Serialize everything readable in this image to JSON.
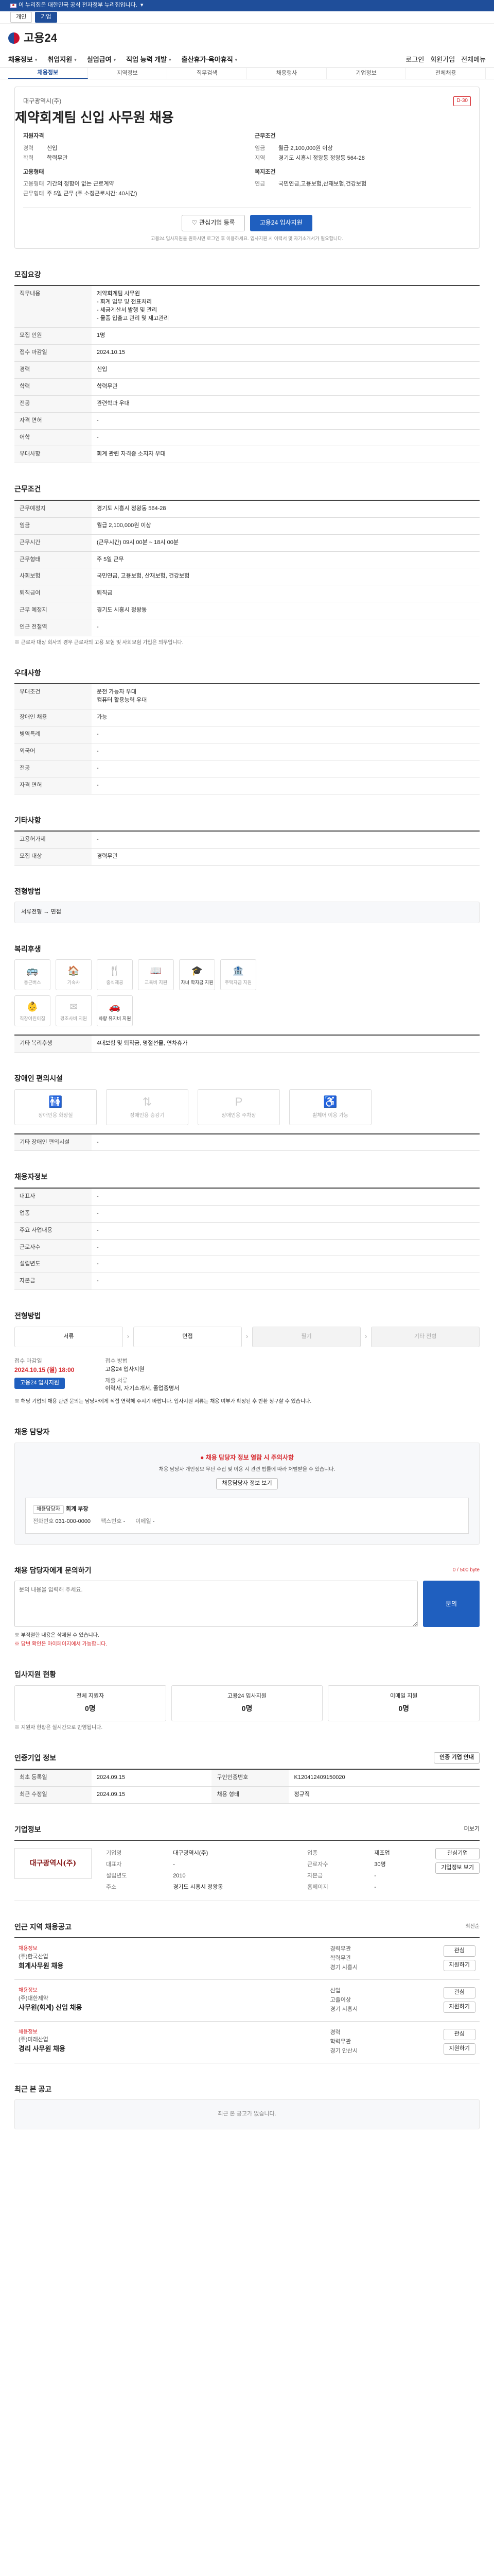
{
  "gov_banner": "이 누리집은 대한민국 공식 전자정부 누리집입니다.",
  "topbar": {
    "left": "개인",
    "right": "기업"
  },
  "logo": "고용24",
  "gnb": [
    "채용정보",
    "취업지원",
    "실업급여",
    "직업 능력 개발",
    "출산휴가·육아휴직"
  ],
  "gnb_right": [
    "로그인",
    "회원가입",
    "전체메뉴"
  ],
  "subnav": [
    "채용정보",
    "지역정보",
    "직무검색",
    "채용행사",
    "기업정보",
    "전체채용"
  ],
  "job": {
    "company": "대구광역시(주)",
    "title": "제약회계팀 신입 사무원 채용",
    "dday": "D-30",
    "qual_title": "지원자격",
    "qual": [
      [
        "경력",
        "신입"
      ],
      [
        "학력",
        "학력무관"
      ]
    ],
    "cond_title": "근무조건",
    "cond": [
      [
        "임금",
        "월급 2,100,000원 이상"
      ],
      [
        "지역",
        "경기도 시흥시 정왕동 정왕동 564-28"
      ]
    ],
    "form_title": "고용형태",
    "form": [
      [
        "고용형태",
        "기간의 정함이 없는 근로계약"
      ],
      [
        "근무형태",
        "주 5일 근무 (주 소정근로시간: 40시간)"
      ]
    ],
    "welfare_title": "복지조건",
    "welfare": [
      [
        "연금",
        "국민연금,고용보험,산재보험,건강보험"
      ]
    ],
    "btn_fav": "관심기업 등록",
    "btn_apply": "고용24 입사지원",
    "note": "고용24 입사지원을 원하시면 로그인 후 이용하세요. 입사지원 시 이력서 및 자기소개서가 필요합니다."
  },
  "recruit": {
    "title": "모집요강",
    "rows": [
      [
        "직무내용",
        "제약회계팀 사무원\n- 회계 업무 및 전표처리\n- 세금계산서 발행 및 관리\n- 물품 입출고 관리 및 재고관리"
      ],
      [
        "모집 인원",
        "1명"
      ],
      [
        "접수 마감일",
        "2024.10.15"
      ],
      [
        "경력",
        "신입"
      ],
      [
        "학력",
        "학력무관"
      ],
      [
        "전공",
        "관련학과 우대"
      ],
      [
        "자격 면허",
        "-"
      ],
      [
        "어학",
        "-"
      ],
      [
        "우대사항",
        "회계 관련 자격증 소지자 우대"
      ]
    ]
  },
  "work": {
    "title": "근무조건",
    "rows": [
      [
        "근무예정지",
        "경기도 시흥시 정왕동 564-28"
      ],
      [
        "임금",
        "월급 2,100,000원 이상"
      ],
      [
        "근무시간",
        "(근무시간) 09시 00분 ~ 18시 00분"
      ],
      [
        "근무형태",
        "주 5일 근무"
      ],
      [
        "사회보험",
        "국민연금, 고용보험, 산재보험, 건강보험"
      ],
      [
        "퇴직급여",
        "퇴직금"
      ],
      [
        "근무 예정지",
        "경기도 시흥시 정왕동"
      ],
      [
        "인근 전철역",
        "-"
      ]
    ],
    "foot": "※ 근로자 대상 회사의 경우 근로자의 고용 보험 및 사회보험 가입은 의무입니다."
  },
  "prefer": {
    "title": "우대사항",
    "rows": [
      [
        "우대조건",
        "운전 가능자 우대\n컴퓨터 활용능력 우대"
      ],
      [
        "장애인 채용",
        "가능"
      ],
      [
        "병역특례",
        "-"
      ],
      [
        "외국어",
        "-"
      ],
      [
        "전공",
        "-"
      ],
      [
        "자격 면허",
        "-"
      ]
    ]
  },
  "etc": {
    "title": "기타사항",
    "rows": [
      [
        "고용허가제",
        "-"
      ],
      [
        "모집 대상",
        "경력무관"
      ]
    ]
  },
  "apply_method": {
    "title": "전형방법",
    "text": "서류전형 → 면접"
  },
  "welfare": {
    "title": "복리후생",
    "items": [
      "통근버스",
      "기숙사",
      "중식제공",
      "교육비 지원",
      "자녀 학자금 지원",
      "주택자금 지원",
      "직장어린이집",
      "경조사비 지원",
      "차량 유지비 지원"
    ],
    "on": [
      4,
      8
    ],
    "extra_label": "기타 복리후생",
    "extra": "4대보험 및 퇴직금, 명절선물, 연차휴가"
  },
  "disability": {
    "title": "장애인 편의시설",
    "items": [
      "장애인용 화장실",
      "장애인용 승강기",
      "장애인용 주차장",
      "휠체어 이용 가능"
    ],
    "label": "기타 장애인 편의시설",
    "val": "-"
  },
  "contact_info": {
    "title": "채용자정보",
    "rows": [
      [
        "대표자",
        "-"
      ],
      [
        "업종",
        "-"
      ],
      [
        "주요 사업내용",
        "-"
      ],
      [
        "근로자수",
        "-"
      ],
      [
        "설립년도",
        "-"
      ],
      [
        "자본금",
        "-"
      ]
    ]
  },
  "apply_area": {
    "title": "전형방법",
    "steps": [
      "서류",
      "면접",
      "필기",
      "기타 전형"
    ],
    "deadline_label": "접수 마감일",
    "deadline": "2024.10.15 (월) 18:00",
    "way_label": "접수 방법",
    "way": "고용24 입사지원",
    "doc_label": "제출 서류",
    "doc": "이력서, 자기소개서, 졸업증명서",
    "btn": "고용24 입사지원",
    "notice": "※ 해당 기업의 채용 관련 문의는 담당자에게 직접 연락해 주시기 바랍니다. 입사지원 서류는 채용 여부가 확정된 후 반환 청구할 수 있습니다."
  },
  "manager": {
    "title": "채용 담당자",
    "alert": "채용 담당자 정보 열람 시 주의사항",
    "alert_text": "채용 담당자 개인정보 무단 수집 및 이용 시 관련 법률에 따라 처벌받을 수 있습니다.",
    "btn": "채용담당자 정보 보기",
    "tag": "채용담당자",
    "name": "회계 부장",
    "phone_label": "전화번호",
    "phone": "031-000-0000",
    "fax_label": "팩스번호",
    "fax": "-",
    "email_label": "이메일",
    "email": "-"
  },
  "inquiry": {
    "title": "채용 담당자에게 문의하기",
    "counter": "0 / 500 byte",
    "placeholder": "문의 내용을 입력해 주세요.",
    "btn": "문의",
    "notes": [
      "※ 부적절한 내용은 삭제될 수 있습니다.",
      "※ 답변 확인은 마이페이지에서 가능합니다."
    ]
  },
  "process": {
    "title": "입사지원 현황",
    "items": [
      [
        "전체 지원자",
        "0명"
      ],
      [
        "고용24 입사지원",
        "0명"
      ],
      [
        "이메일 지원",
        "0명"
      ]
    ],
    "foot": "※ 지원자 현황은 실시간으로 반영됩니다."
  },
  "posting": {
    "title": "인증기업 정보",
    "rows": [
      [
        "최초 등록일",
        "2024.09.15",
        "구인인증번호",
        "K120412409150020"
      ],
      [
        "최근 수정일",
        "2024.09.15",
        "채용 형태",
        "정규직"
      ]
    ],
    "btn": "인증 기업 안내"
  },
  "company": {
    "title": "기업정보",
    "more": "더보기",
    "name": "대구광역시(주)",
    "rows": [
      [
        "기업명",
        "대구광역시(주)",
        "업종",
        "제조업"
      ],
      [
        "대표자",
        "-",
        "근로자수",
        "30명"
      ],
      [
        "설립년도",
        "2010",
        "자본금",
        "-"
      ],
      [
        "주소",
        "경기도 시흥시 정왕동",
        "홈페이지",
        "-"
      ]
    ],
    "btns": [
      "관심기업",
      "기업정보 보기"
    ]
  },
  "similar": {
    "title": "인근 지역 채용공고",
    "sort": "최신순",
    "items": [
      {
        "tag": "채용정보",
        "co": "(주)한국산업",
        "title": "회계사무원 채용",
        "info": [
          "경력무관",
          "학력무관",
          "경기 시흥시"
        ],
        "btns": [
          "관심",
          "지원하기"
        ]
      },
      {
        "tag": "채용정보",
        "co": "(주)대한제약",
        "title": "사무원(회계) 신입 채용",
        "info": [
          "신입",
          "고졸이상",
          "경기 시흥시"
        ],
        "btns": [
          "관심",
          "지원하기"
        ]
      },
      {
        "tag": "채용정보",
        "co": "(주)미래산업",
        "title": "경리 사무원 채용",
        "info": [
          "경력",
          "학력무관",
          "경기 안산시"
        ],
        "btns": [
          "관심",
          "지원하기"
        ]
      }
    ]
  },
  "recent": {
    "title": "최근 본 공고",
    "empty": "최근 본 공고가 없습니다."
  }
}
